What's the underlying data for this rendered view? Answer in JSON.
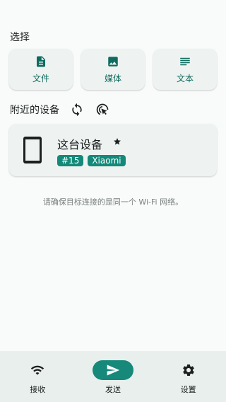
{
  "select": {
    "title": "选择",
    "cards": [
      {
        "label": "文件",
        "icon": "file-icon"
      },
      {
        "label": "媒体",
        "icon": "image-icon"
      },
      {
        "label": "文本",
        "icon": "text-icon"
      }
    ]
  },
  "nearby": {
    "title": "附近的设备",
    "refresh_icon": "refresh-icon",
    "scan_icon": "touch-scan-icon"
  },
  "device": {
    "name": "这台设备",
    "badges": [
      "#15",
      "Xiaomi"
    ]
  },
  "hint": "请确保目标连接的是同一个 Wi-Fi 网络。",
  "nav": {
    "items": [
      {
        "label": "接收",
        "icon": "wifi-icon"
      },
      {
        "label": "发送",
        "icon": "send-icon"
      },
      {
        "label": "设置",
        "icon": "gear-icon"
      }
    ],
    "active": 1
  },
  "colors": {
    "accent": "#16897a",
    "accent_text": "#0f6b5f",
    "card_bg": "#eef3f1",
    "nav_bg": "#e8efed"
  }
}
